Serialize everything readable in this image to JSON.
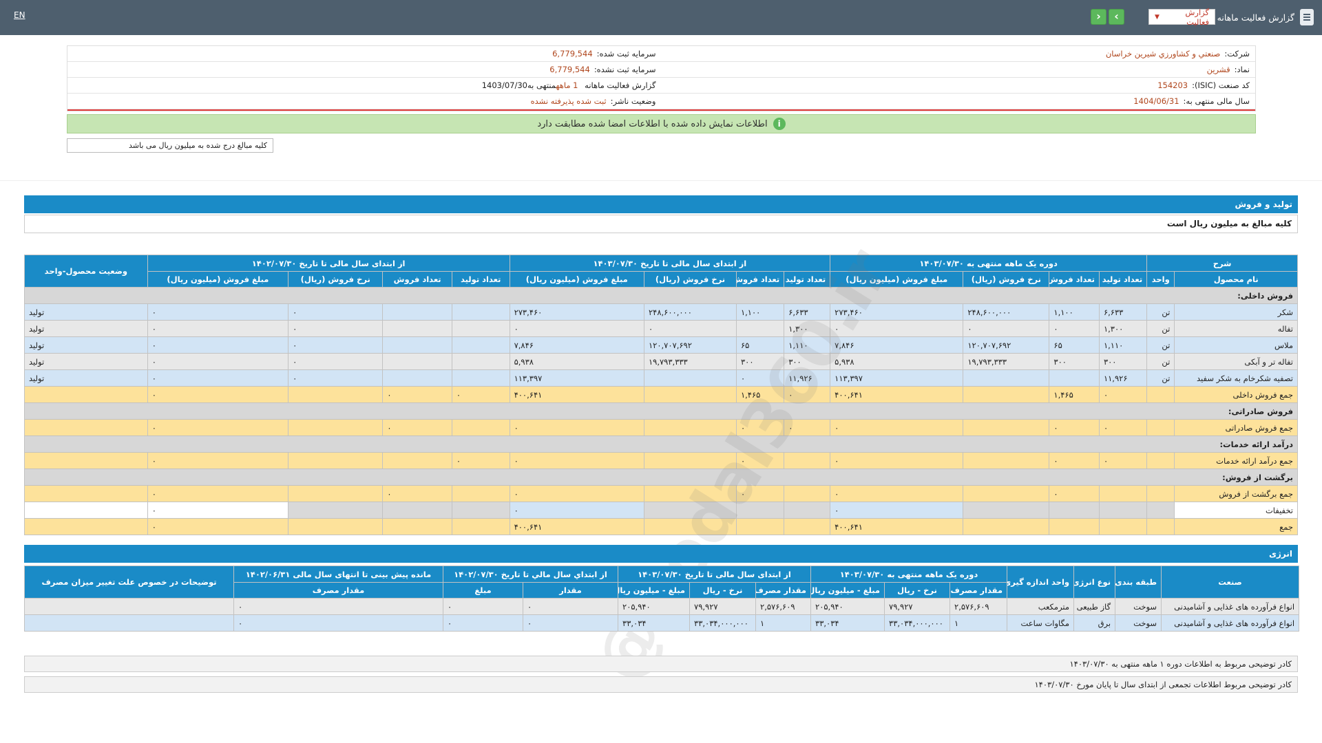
{
  "topbar": {
    "title": "گزارش فعالیت ماهانه",
    "report_select": "گزارش فعالیت",
    "lang": "EN"
  },
  "info": {
    "company_label": "شرکت:",
    "company": "صنعتي و کشاورزي شيرين خراسان",
    "capital_label": "سرمایه ثبت شده:",
    "capital": "6,779,544",
    "symbol_label": "نماد:",
    "symbol": "قشرین",
    "unreg_capital_label": "سرمایه ثبت نشده:",
    "unreg_capital": "6,779,544",
    "isic_label": "کد صنعت (ISIC):",
    "isic": "154203",
    "period_label": "گزارش فعالیت ماهانه",
    "period": "1 ماهه",
    "period_end": "منتهی به1403/07/30",
    "fiscal_label": "سال مالی منتهی به:",
    "fiscal": "1404/06/31",
    "status_label": "وضعیت ناشر:",
    "status": "ثبت شده پذیرفته نشده"
  },
  "banner": "اطلاعات نمایش داده شده با اطلاعات امضا شده مطابقت دارد",
  "amount_note": "کلیه مبالغ درج شده به میلیون ریال می باشد",
  "production": {
    "title": "تولید و فروش",
    "note": "کلیه مبالغ به میلیون ریال است",
    "group_headers": [
      "شرح",
      "دوره یک ماهه منتهی به ۱۴۰۳/۰۷/۳۰",
      "از ابتدای سال مالی تا تاریخ ۱۴۰۳/۰۷/۳۰",
      "از ابتدای سال مالی تا تاریخ ۱۴۰۲/۰۷/۳۰",
      "وضعیت محصول-واحد"
    ],
    "sub_headers": [
      "نام محصول",
      "واحد",
      "تعداد تولید",
      "تعداد فروش",
      "نرخ فروش (ریال)",
      "مبلغ فروش (میلیون ریال)",
      "تعداد تولید",
      "تعداد فروش",
      "نرخ فروش (ریال)",
      "مبلغ فروش (میلیون ریال)",
      "تعداد تولید",
      "تعداد فروش",
      "نرخ فروش (ریال)",
      "مبلغ فروش (میلیون ریال)"
    ],
    "rows": [
      {
        "cls": "grayhead",
        "cells": [
          "فروش داخلی:",
          "",
          "",
          "",
          "",
          "",
          "",
          "",
          "",
          "",
          "",
          "",
          "",
          "",
          ""
        ]
      },
      {
        "cls": "blue",
        "cells": [
          "شکر",
          "تن",
          "۶,۶۳۳",
          "۱,۱۰۰",
          "۲۴۸,۶۰۰,۰۰۰",
          "۲۷۳,۴۶۰",
          "۶,۶۳۳",
          "۱,۱۰۰",
          "۲۴۸,۶۰۰,۰۰۰",
          "۲۷۳,۴۶۰",
          "",
          "",
          "۰",
          "۰",
          "تولید"
        ]
      },
      {
        "cls": "gray",
        "cells": [
          "تفاله",
          "تن",
          "۱,۳۰۰",
          "۰",
          "۰",
          "۰",
          "۱,۳۰۰",
          "",
          "۰",
          "۰",
          "",
          "",
          "۰",
          "۰",
          "تولید"
        ]
      },
      {
        "cls": "blue",
        "cells": [
          "ملاس",
          "تن",
          "۱,۱۱۰",
          "۶۵",
          "۱۲۰,۷۰۷,۶۹۲",
          "۷,۸۴۶",
          "۱,۱۱۰",
          "۶۵",
          "۱۲۰,۷۰۷,۶۹۲",
          "۷,۸۴۶",
          "",
          "",
          "۰",
          "۰",
          "تولید"
        ]
      },
      {
        "cls": "gray",
        "cells": [
          "تفاله تر و آبکی",
          "تن",
          "۳۰۰",
          "۳۰۰",
          "۱۹,۷۹۳,۳۳۳",
          "۵,۹۳۸",
          "۳۰۰",
          "۳۰۰",
          "۱۹,۷۹۳,۳۳۳",
          "۵,۹۳۸",
          "",
          "",
          "۰",
          "۰",
          "تولید"
        ]
      },
      {
        "cls": "blue",
        "cells": [
          "تصفیه شکرخام به شکر سفید",
          "تن",
          "۱۱,۹۲۶",
          "",
          "",
          "۱۱۳,۳۹۷",
          "۱۱,۹۲۶",
          "۰",
          "",
          "۱۱۳,۳۹۷",
          "",
          "",
          "۰",
          "۰",
          "تولید"
        ]
      },
      {
        "cls": "yellow",
        "cells": [
          "جمع فروش داخلی",
          "",
          "۰",
          "۱,۴۶۵",
          "",
          "۴۰۰,۶۴۱",
          "۰",
          "۱,۴۶۵",
          "",
          "۴۰۰,۶۴۱",
          "۰",
          "۰",
          "",
          "۰",
          ""
        ]
      },
      {
        "cls": "grayhead",
        "cells": [
          "فروش صادراتی:",
          "",
          "",
          "",
          "",
          "",
          "",
          "",
          "",
          "",
          "",
          "",
          "",
          "",
          ""
        ]
      },
      {
        "cls": "yellow",
        "cells": [
          "جمع فروش صادراتی",
          "",
          "۰",
          "۰",
          "",
          "۰",
          "۰",
          "۰",
          "",
          "۰",
          "",
          "۰",
          "",
          "۰",
          ""
        ]
      },
      {
        "cls": "grayhead",
        "cells": [
          "درآمد ارائه خدمات:",
          "",
          "",
          "",
          "",
          "",
          "",
          "",
          "",
          "",
          "",
          "",
          "",
          "",
          ""
        ]
      },
      {
        "cls": "yellow",
        "cells": [
          "جمع درآمد ارائه خدمات",
          "",
          "۰",
          "۰",
          "",
          "۰",
          "",
          "۰",
          "",
          "۰",
          "۰",
          "",
          "",
          "۰",
          ""
        ]
      },
      {
        "cls": "grayhead",
        "cells": [
          "برگشت از فروش:",
          "",
          "",
          "",
          "",
          "",
          "",
          "",
          "",
          "",
          "",
          "",
          "",
          "",
          ""
        ]
      },
      {
        "cls": "yellow",
        "cells": [
          "جمع برگشت از فروش",
          "",
          "",
          "۰",
          "",
          "۰",
          "",
          "۰",
          "",
          "۰",
          "",
          "۰",
          "",
          "۰",
          ""
        ]
      },
      {
        "cls": "white",
        "cells": [
          "تخفیفات",
          "",
          "",
          "",
          "",
          "۰",
          "",
          "",
          "",
          "۰",
          "",
          "",
          "",
          "۰",
          ""
        ]
      },
      {
        "cls": "yellow",
        "cells": [
          "جمع",
          "",
          "",
          "",
          "",
          "۴۰۰,۶۴۱",
          "",
          "",
          "",
          "۴۰۰,۶۴۱",
          "",
          "",
          "",
          "۰",
          ""
        ]
      }
    ]
  },
  "energy": {
    "title": "انرژی",
    "group_headers": [
      "صنعت",
      "طبقه بندی",
      "نوع انرژی",
      "واحد اندازه گیری",
      "دوره یک ماهه منتهی به ۱۴۰۳/۰۷/۳۰",
      "از ابتدای سال مالی تا تاریخ ۱۴۰۳/۰۷/۳۰",
      "از ابتداي سال مالي تا تاريخ ۱۴۰۲/۰۷/۳۰",
      "مانده پیش بینی تا انتهای سال مالی ۱۴۰۲/۰۶/۳۱",
      "توضیحات در خصوص علت تغییر میزان مصرف"
    ],
    "sub_headers": [
      "مقدار مصرف",
      "نرخ - ریال",
      "مبلغ - میلیون ریال",
      "مقدار مصرف",
      "نرخ - ریال",
      "مبلغ - میلیون ریال",
      "مقدار",
      "مبلغ",
      "مقدار مصرف"
    ],
    "rows": [
      {
        "cls": "gray",
        "cells": [
          "انواع فرآورده های غذایی و آشامیدنی",
          "سوخت",
          "گاز طبیعی",
          "مترمکعب",
          "۲,۵۷۶,۶۰۹",
          "۷۹,۹۲۷",
          "۲۰۵,۹۴۰",
          "۲,۵۷۶,۶۰۹",
          "۷۹,۹۲۷",
          "۲۰۵,۹۴۰",
          "۰",
          "۰",
          "۰",
          ""
        ]
      },
      {
        "cls": "blue",
        "cells": [
          "انواع فرآورده های غذایی و آشامیدنی",
          "سوخت",
          "برق",
          "مگاوات ساعت",
          "۱",
          "۳۳,۰۳۴,۰۰۰,۰۰۰",
          "۳۳,۰۳۴",
          "۱",
          "۳۳,۰۳۴,۰۰۰,۰۰۰",
          "۳۳,۰۳۴",
          "۰",
          "۰",
          "۰",
          ""
        ]
      }
    ]
  },
  "descriptions": [
    "کادر توضیحی مربوط به اطلاعات دوره ۱ ماهه منتهی به ۱۴۰۳/۰۷/۳۰",
    "کادر توضیحی مربوط اطلاعات تجمعی از ابتدای سال تا پایان مورخ ۱۴۰۳/۰۷/۳۰"
  ],
  "watermark": "@Codal360.ir"
}
